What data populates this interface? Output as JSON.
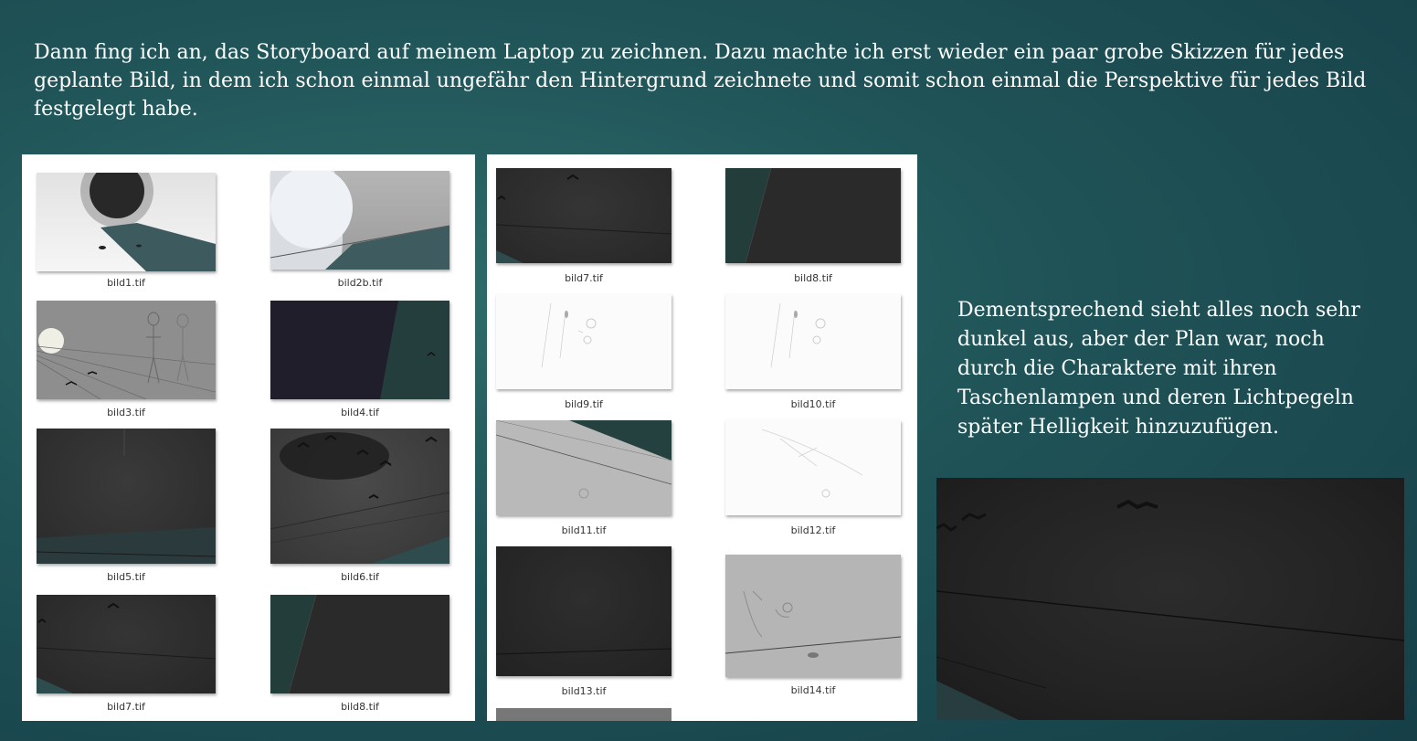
{
  "slide": {
    "intro_text": "Dann fing ich an, das Storyboard auf meinem Laptop zu zeichnen. Dazu machte ich erst wieder ein paar grobe Skizzen für jedes geplante Bild, in dem ich schon einmal ungefähr den Hintergrund zeichnete und somit schon einmal die Perspektive für jedes Bild festgelegt habe.",
    "side_text": "Dementsprechend sieht alles noch sehr dunkel aus, aber der Plan war, noch durch die Charaktere mit ihren Taschenlampen und deren Lichtpegeln später Helligkeit hinzuzufügen."
  },
  "left_panel": {
    "files": [
      {
        "name": "bild1.tif",
        "icon": "moon-sketch-thumbnail"
      },
      {
        "name": "bild2b.tif",
        "icon": "tunnel-sketch-thumbnail"
      },
      {
        "name": "bild3.tif",
        "icon": "characters-sketch-thumbnail"
      },
      {
        "name": "bild4.tif",
        "icon": "dark-night-thumbnail"
      },
      {
        "name": "bild5.tif",
        "icon": "dark-ground-thumbnail"
      },
      {
        "name": "bild6.tif",
        "icon": "bat-swarm-thumbnail"
      },
      {
        "name": "bild7.tif",
        "icon": "dark-bats-thumbnail"
      },
      {
        "name": "bild8.tif",
        "icon": "dark-slope-thumbnail"
      }
    ]
  },
  "right_panel": {
    "files": [
      {
        "name": "bild7.tif",
        "icon": "dark-bats-thumbnail"
      },
      {
        "name": "bild8.tif",
        "icon": "dark-slope-thumbnail"
      },
      {
        "name": "bild9.tif",
        "icon": "light-sketch-thumbnail"
      },
      {
        "name": "bild10.tif",
        "icon": "light-sketch-thumbnail"
      },
      {
        "name": "bild11.tif",
        "icon": "grey-slope-thumbnail"
      },
      {
        "name": "bild12.tif",
        "icon": "light-sketch-thumbnail"
      },
      {
        "name": "bild13.tif",
        "icon": "dark-thumbnail"
      },
      {
        "name": "bild14.tif",
        "icon": "grey-sketch-thumbnail"
      }
    ]
  },
  "preview": {
    "icon": "dark-bats-preview-image"
  }
}
